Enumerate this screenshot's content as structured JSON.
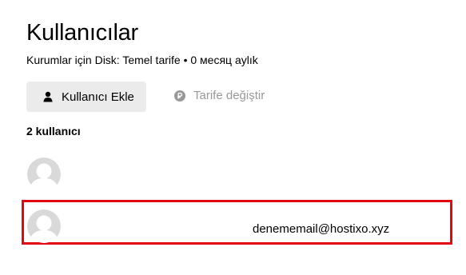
{
  "header": {
    "title": "Kullanıcılar",
    "subtitle": "Kurumlar için Disk: Temel tarife • 0 месяц aylık"
  },
  "actions": {
    "add_user_label": "Kullanıcı Ekle",
    "change_plan_label": "Tarife değiştir"
  },
  "users": {
    "count_label": "2 kullanıcı",
    "items": [
      {
        "email": ""
      },
      {
        "email": "denememail@hostixo.xyz"
      }
    ]
  },
  "colors": {
    "highlight_border": "#e30613",
    "button_bg": "#ebebeb",
    "muted_text": "#999999",
    "avatar_bg": "#d9d9d9"
  },
  "icons": {
    "add_user": "user-icon",
    "change_plan": "ruble-icon",
    "avatar": "avatar-placeholder-icon"
  }
}
